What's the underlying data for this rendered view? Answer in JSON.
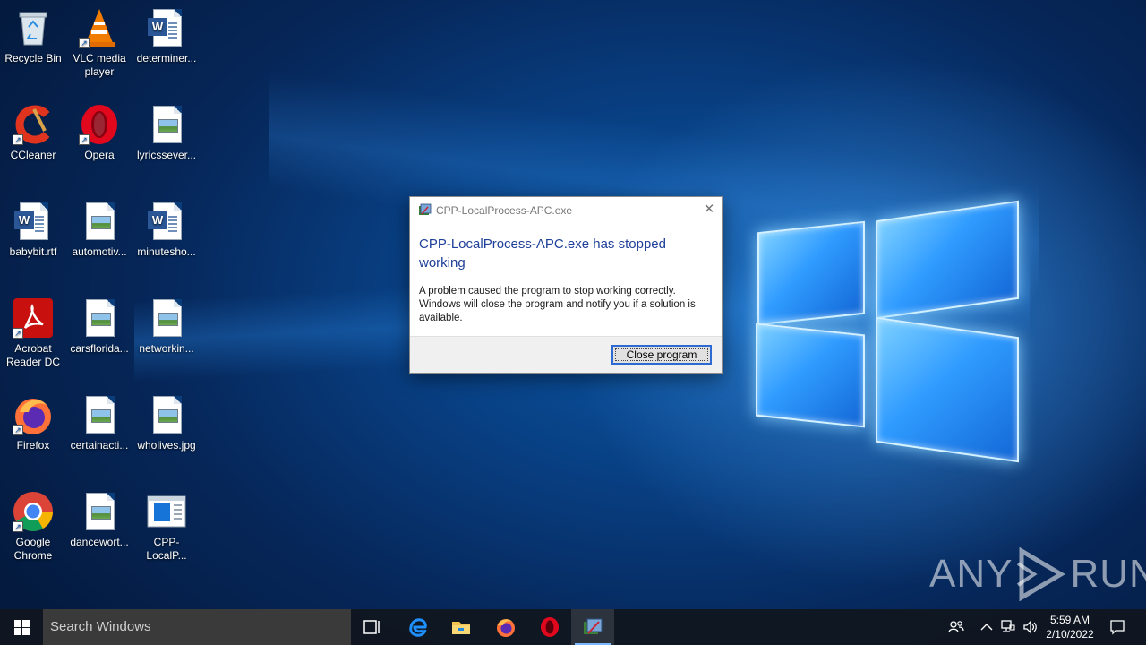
{
  "desktop": {
    "icons": [
      {
        "label": "Recycle Bin"
      },
      {
        "label": "VLC media player"
      },
      {
        "label": "determiner..."
      },
      {
        "label": "CCleaner"
      },
      {
        "label": "Opera"
      },
      {
        "label": "lyricssever..."
      },
      {
        "label": "babybit.rtf"
      },
      {
        "label": "automotiv..."
      },
      {
        "label": "minutesho..."
      },
      {
        "label": "Acrobat Reader DC"
      },
      {
        "label": "carsflorida..."
      },
      {
        "label": "networkin..."
      },
      {
        "label": "Firefox"
      },
      {
        "label": "certainacti..."
      },
      {
        "label": "wholives.jpg"
      },
      {
        "label": "Google Chrome"
      },
      {
        "label": "dancewort..."
      },
      {
        "label": "CPP-LocalP..."
      }
    ]
  },
  "dialog": {
    "title": "CPP-LocalProcess-APC.exe",
    "close_glyph": "✕",
    "heading": "CPP-LocalProcess-APC.exe has stopped working",
    "message": "A problem caused the program to stop working correctly. Windows will close the program and notify you if a solution is available.",
    "button_label": "Close program"
  },
  "watermark": {
    "left": "ANY",
    "right": "RUN"
  },
  "taskbar": {
    "search_placeholder": "Search Windows",
    "clock_time": "5:59 AM",
    "clock_date": "2/10/2022",
    "pinned": [
      "task-view",
      "edge",
      "file-explorer",
      "firefox",
      "opera",
      "cpp-localprocess"
    ]
  },
  "colors": {
    "accent": "#2d6ad1",
    "dialog_heading": "#1e3f9a",
    "taskbar": "#10161f"
  }
}
